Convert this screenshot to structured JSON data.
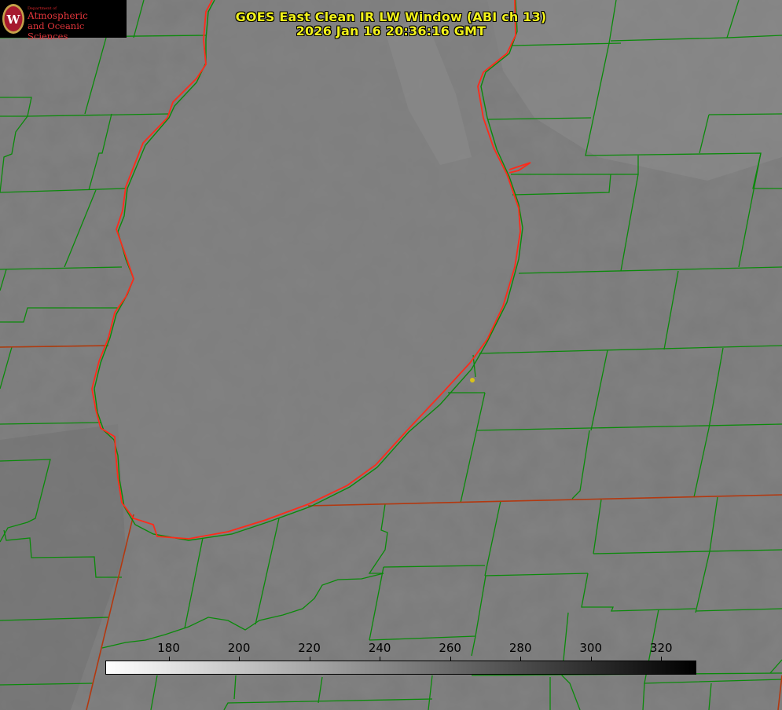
{
  "title": {
    "line1": "GOES East Clean IR LW Window (ABI ch 13)",
    "line2": "2026 Jan 16 20:36:16 GMT"
  },
  "logo": {
    "department": "Department of",
    "line1": "Atmospheric",
    "line2": "and Oceanic Sciences",
    "seal_letter": "W"
  },
  "colorbar": {
    "min": 162,
    "max": 330,
    "ticks": [
      "180",
      "200",
      "220",
      "240",
      "260",
      "280",
      "300",
      "320"
    ],
    "tick_values": [
      180,
      200,
      220,
      240,
      260,
      280,
      300,
      320
    ],
    "scale": "grayscale-inverted (white = cold, black = warm)"
  },
  "colors": {
    "background_gray": "#7c7c7c",
    "county_lines": "#0a8a0a",
    "lake_outline": "#ff2a1a",
    "state_border": "#b3380f",
    "title_text": "#f2f21a",
    "marker": "#d8c21a"
  },
  "map_features": {
    "lake": "lake outline",
    "point_marker": "yellow dot"
  }
}
